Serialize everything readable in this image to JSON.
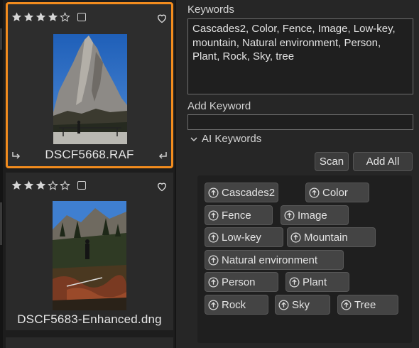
{
  "filmstrip": {
    "items": [
      {
        "rating": 4,
        "max_rating": 5,
        "filename": "DSCF5668.RAF",
        "selected": true
      },
      {
        "rating": 3,
        "max_rating": 5,
        "filename": "DSCF5683-Enhanced.dng",
        "selected": false
      }
    ]
  },
  "keywords": {
    "label": "Keywords",
    "value": "Cascades2, Color, Fence, Image, Low-key, mountain, Natural environment, Person, Plant, Rock, Sky, tree"
  },
  "add_keyword": {
    "label": "Add Keyword",
    "value": ""
  },
  "ai_keywords": {
    "label": "AI Keywords",
    "expanded": true,
    "scan_label": "Scan",
    "add_all_label": "Add All",
    "chips": [
      "Cascades2",
      "Color",
      "Fence",
      "Image",
      "Low-key",
      "Mountain",
      "Natural environment",
      "Person",
      "Plant",
      "Rock",
      "Sky",
      "Tree"
    ]
  },
  "colors": {
    "selection_accent": "#f28c1e",
    "panel_bg": "#262626",
    "chip_bg": "#444444"
  }
}
